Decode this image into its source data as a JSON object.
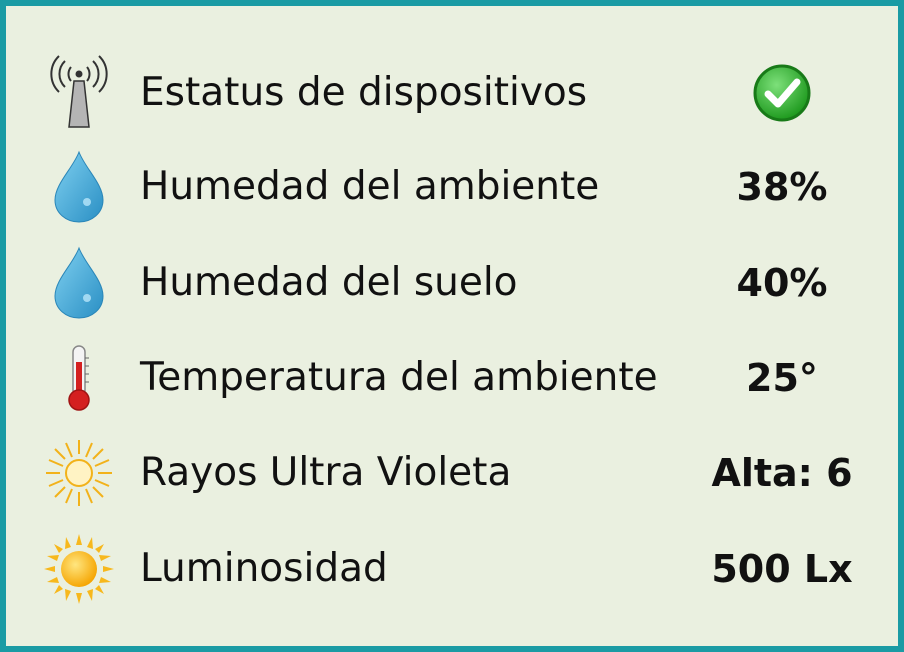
{
  "panel": {
    "border_color": "#1a9ba4",
    "background": "#eaf0e0",
    "rows": [
      {
        "icon": "antenna-icon",
        "label": "Estatus de dispositivos",
        "status": "ok",
        "status_icon": "check-circle-icon",
        "status_color": "#2db52d"
      },
      {
        "icon": "water-drop-icon",
        "label": "Humedad del ambiente",
        "value": "38%"
      },
      {
        "icon": "water-drop-icon",
        "label": "Humedad del suelo",
        "value": "40%"
      },
      {
        "icon": "thermometer-icon",
        "label": "Temperatura del ambiente",
        "value": "25°"
      },
      {
        "icon": "sun-outline-icon",
        "label": "Rayos Ultra Violeta",
        "value": "Alta: 6"
      },
      {
        "icon": "sun-icon",
        "label": "Luminosidad",
        "value": "500 Lx"
      }
    ]
  }
}
